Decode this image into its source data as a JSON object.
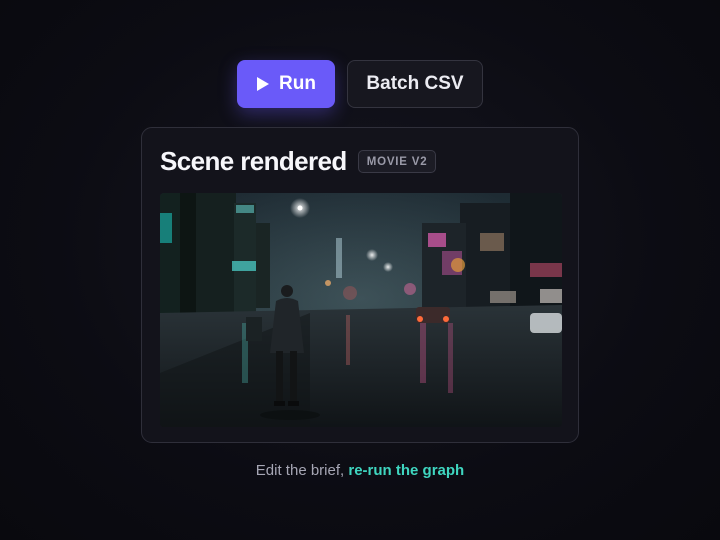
{
  "toolbar": {
    "run_label": "Run",
    "run_icon": "play-icon",
    "batch_label": "Batch CSV"
  },
  "result_card": {
    "title": "Scene rendered",
    "badge": "MOVIE V2",
    "preview": {
      "description_icon": "scene-preview-image"
    }
  },
  "footer": {
    "text": "Edit the brief,",
    "link_label": "re-run the graph"
  },
  "colors": {
    "accent": "#6a5af9",
    "link": "#3fd6c0"
  }
}
